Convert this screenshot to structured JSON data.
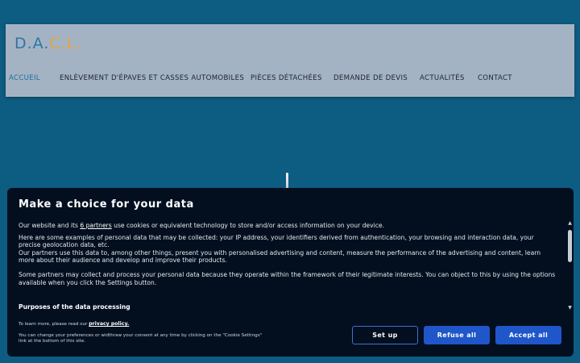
{
  "site": {
    "logo_main": "D.A.",
    "logo_accent": "C.L.",
    "logo_end": ".",
    "nav": [
      {
        "label": "ACCUEIL",
        "active": true
      },
      {
        "label": "ENLÈVEMENT D'ÉPAVES ET CASSES AUTOMOBILES",
        "active": false
      },
      {
        "label": "PIÈCES DÉTACHÉES",
        "active": false
      },
      {
        "label": "DEMANDE DE DEVIS",
        "active": false
      },
      {
        "label": "ACTUALITÉS",
        "active": false
      },
      {
        "label": "CONTACT",
        "active": false
      }
    ]
  },
  "consent": {
    "title": "Make a choice for your data",
    "p1_before": "Our website and its ",
    "p1_link": "6 partners",
    "p1_after": " use cookies or equivalent technology to store and/or access information on your device.",
    "p2": "Here are some examples of personal data that may be collected: your IP address, your identifiers derived from authentication, your browsing and interaction data, your precise geolocation data, etc.",
    "p3": "Our partners use this data to, among other things, present you with personalised advertising and content, measure the performance of the advertising and content, learn more about their audience and develop and improve their products.",
    "p4": "Some partners may collect and process your personal data because they operate within the framework of their legitimate interests. You can object to this by using the options available when you click the Settings button.",
    "purposes_title": "Purposes of the data processing",
    "learn_more_text": "To learn more, please read our ",
    "privacy_link": "privacy policy.",
    "change_prefs": "You can change your preferences or widthraw your consent at any time by clicking on the \"Cookie Settings\" link at the bottom of this site.",
    "buttons": {
      "setup": "Set up",
      "refuse": "Refuse all",
      "accept": "Accept all"
    }
  },
  "colors": {
    "page_bg": "#0d5c82",
    "header_bg": "#a4b3c3",
    "logo": "#2e75a8",
    "logo_accent": "#e3a53e",
    "nav_active": "#1f6e9e",
    "consent_bg": "#030f1f",
    "primary_button": "#1f56c9"
  },
  "icons": {
    "scroll_up": "chevron-up-icon",
    "scroll_down": "chevron-down-icon",
    "loading": "loading-spinner-icon"
  }
}
